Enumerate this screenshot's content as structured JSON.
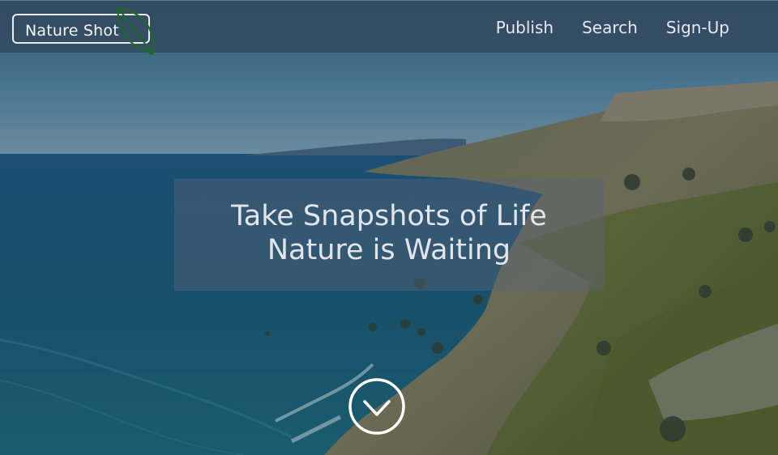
{
  "brand": {
    "name": "Nature Shot",
    "logo_icon": "leaf-icon",
    "leaf_color": "#1b6b22"
  },
  "nav": {
    "items": [
      {
        "label": "Publish"
      },
      {
        "label": "Search"
      },
      {
        "label": "Sign-Up"
      }
    ]
  },
  "hero": {
    "line1": "Take Snapshots of Life",
    "line2": "Nature is Waiting",
    "scroll_icon": "chevron-down-circle-icon"
  },
  "colors": {
    "navbar_bg": "#344a60",
    "text_light": "#e6eaee",
    "sea": "#1e5a73",
    "sky": "#5f90b8"
  }
}
